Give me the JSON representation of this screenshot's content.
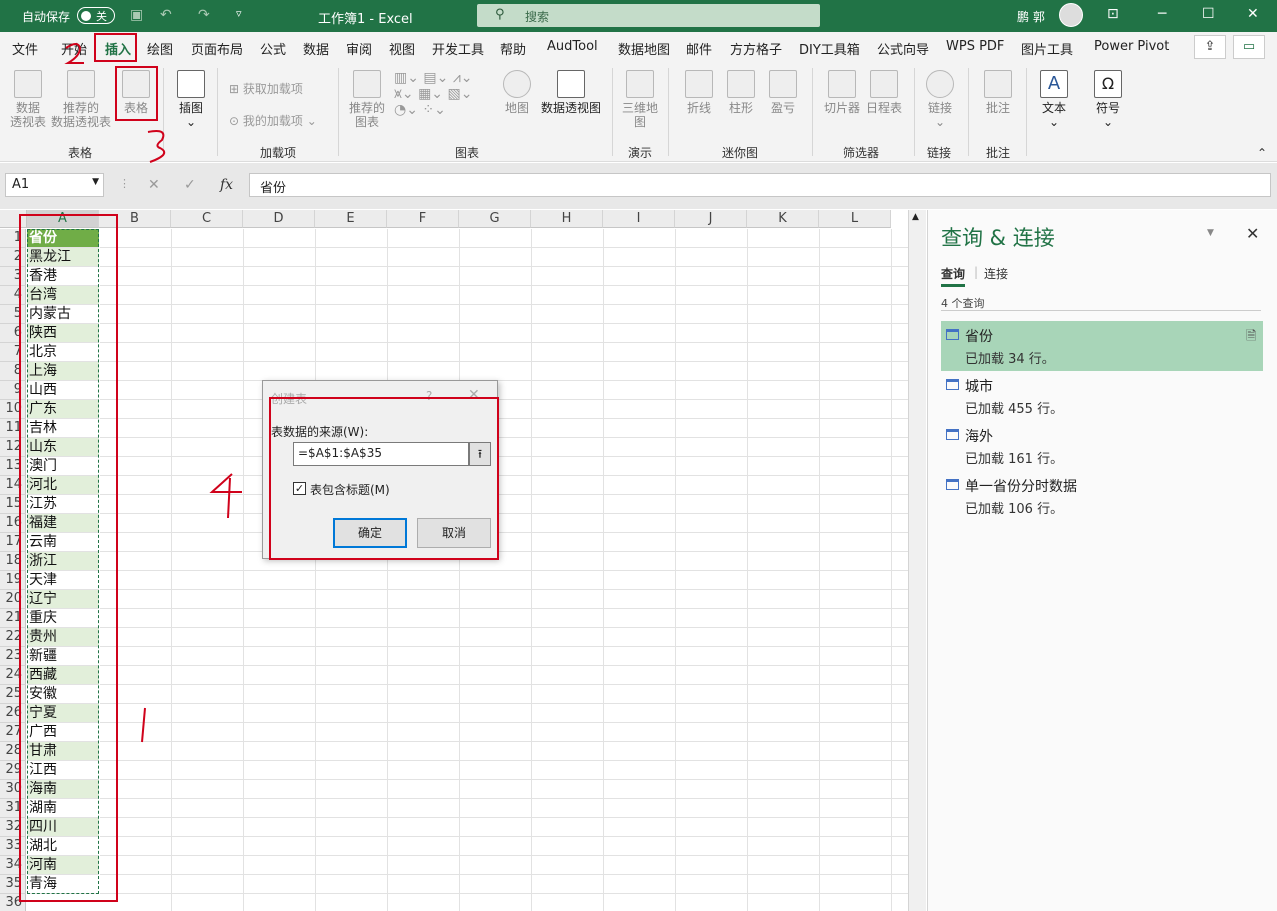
{
  "titlebar": {
    "autosave_label": "自动保存",
    "autosave_state": "关",
    "doc_title": "工作簿1  -  Excel",
    "search_placeholder": "搜索",
    "user_name": "鹏 郭"
  },
  "menu": {
    "tabs": [
      "文件",
      "开始",
      "插入",
      "绘图",
      "页面布局",
      "公式",
      "数据",
      "审阅",
      "视图",
      "开发工具",
      "帮助",
      "AudTool",
      "数据地图",
      "邮件",
      "方方格子",
      "DIY工具箱",
      "公式向导",
      "WPS PDF",
      "图片工具",
      "Power Pivot"
    ],
    "active_tab": "插入"
  },
  "ribbon": {
    "pivot1": "数据\n透视表",
    "pivot2": "推荐的\n数据透视表",
    "table": "表格",
    "illust": "插图",
    "addin_get": "获取加载项",
    "addin_mine": "我的加载项",
    "rec_chart": "推荐的\n图表",
    "map": "地图",
    "pivot_chart": "数据透视图",
    "map3d": "三维地\n图",
    "line": "折线",
    "column": "柱形",
    "winloss": "盈亏",
    "slicer": "切片器",
    "timeline": "日程表",
    "link": "链接",
    "comment": "批注",
    "text": "文本",
    "symbol": "符号",
    "groups": {
      "tables": "表格",
      "addins": "加载项",
      "charts": "图表",
      "tours": "演示",
      "sparklines": "迷你图",
      "filters": "筛选器",
      "links": "链接",
      "comments": "批注"
    }
  },
  "formula_bar": {
    "name_box": "A1",
    "formula": "省份"
  },
  "sheet": {
    "columns": [
      "A",
      "B",
      "C",
      "D",
      "E",
      "F",
      "G",
      "H",
      "I",
      "J",
      "K",
      "L"
    ],
    "rows": [
      "1",
      "2",
      "3",
      "4",
      "5",
      "6",
      "7",
      "8",
      "9",
      "10",
      "11",
      "12",
      "13",
      "14",
      "15",
      "16",
      "17",
      "18",
      "19",
      "20",
      "21",
      "22",
      "23",
      "24",
      "25",
      "26",
      "27",
      "28",
      "29",
      "30",
      "31",
      "32",
      "33",
      "34",
      "35",
      "36"
    ],
    "col_a": [
      "省份",
      "黑龙江",
      "香港",
      "台湾",
      "内蒙古",
      "陕西",
      "北京",
      "上海",
      "山西",
      "广东",
      "吉林",
      "山东",
      "澳门",
      "河北",
      "江苏",
      "福建",
      "云南",
      "浙江",
      "天津",
      "辽宁",
      "重庆",
      "贵州",
      "新疆",
      "西藏",
      "安徽",
      "宁夏",
      "广西",
      "甘肃",
      "江西",
      "海南",
      "湖南",
      "四川",
      "湖北",
      "河南",
      "青海"
    ]
  },
  "panel": {
    "title": "查询 & 连接",
    "tab_queries": "查询",
    "tab_connections": "连接",
    "count": "4 个查询",
    "queries": [
      {
        "name": "省份",
        "status": "已加载 34 行。"
      },
      {
        "name": "城市",
        "status": "已加载 455 行。"
      },
      {
        "name": "海外",
        "status": "已加载 161 行。"
      },
      {
        "name": "单一省份分时数据",
        "status": "已加载 106 行。"
      }
    ]
  },
  "dialog": {
    "title": "创建表",
    "help": "?",
    "source_label": "表数据的来源(W):",
    "source_value": "=$A$1:$A$35",
    "header_checkbox": "表包含标题(M)",
    "header_checked": true,
    "ok": "确定",
    "cancel": "取消"
  },
  "annotations": {
    "accent": "#d0021b",
    "brand": "#217346"
  }
}
